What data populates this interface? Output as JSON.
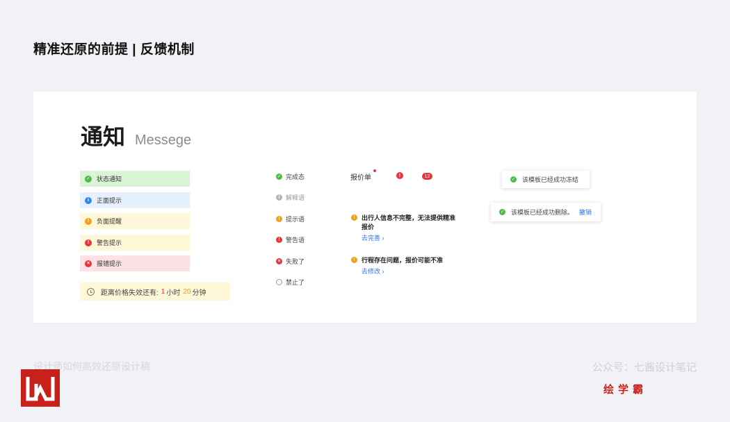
{
  "header": {
    "title": "精准还原的前提 | 反馈机制"
  },
  "card": {
    "title_zh": "通知",
    "title_en": "Messege"
  },
  "notices": [
    {
      "label": "状态通知",
      "bg": "#d9f5d6",
      "color": "#4fb94a",
      "icon": "check-circle-icon",
      "glyph": "✓"
    },
    {
      "label": "正面提示",
      "bg": "#e7f1fd",
      "color": "#2f8be6",
      "icon": "info-circle-icon",
      "glyph": "i"
    },
    {
      "label": "负面提醒",
      "bg": "#fff8d8",
      "color": "#f0a020",
      "icon": "warning-circle-icon",
      "glyph": "!"
    },
    {
      "label": "警告提示",
      "bg": "#fff8d8",
      "color": "#e8343f",
      "icon": "alert-circle-icon",
      "glyph": "!"
    },
    {
      "label": "报错提示",
      "bg": "#fde1e4",
      "color": "#e8343f",
      "icon": "error-circle-icon",
      "glyph": "×"
    }
  ],
  "timer": {
    "prefix": "距离价格失效还有:",
    "hours": "1",
    "hour_unit": "小时",
    "minutes": "20",
    "minute_unit": "分钟"
  },
  "statuses": [
    {
      "label": "完成态",
      "color": "#4fb94a",
      "icon": "check-circle-icon",
      "glyph": "✓"
    },
    {
      "label": "解释语",
      "color": "#b5b5b5",
      "icon": "info-circle-icon",
      "glyph": "i"
    },
    {
      "label": "提示语",
      "color": "#f0a020",
      "icon": "warning-circle-icon",
      "glyph": "!"
    },
    {
      "label": "警告语",
      "color": "#e8343f",
      "icon": "alert-circle-icon",
      "glyph": "!"
    },
    {
      "label": "失败了",
      "color": "#e8343f",
      "icon": "error-circle-icon",
      "glyph": "×"
    },
    {
      "label": "禁止了",
      "color": "#9a9a9a",
      "icon": "forbidden-icon",
      "glyph": "⃠"
    }
  ],
  "quote": {
    "label": "报价单",
    "badge_count": "12",
    "badge_glyph": "!"
  },
  "tips": [
    {
      "text_line1": "出行人信息不完整，无法提供精准",
      "text_line2": "报价",
      "link": "去完善  ›"
    },
    {
      "text_line1": "行程存在问题，报价可能不准",
      "text_line2": "",
      "link": "去修改  ›"
    }
  ],
  "toasts": {
    "freeze": "该模板已经成功冻结",
    "delete": "该模板已经成功删除。",
    "undo": "撤销"
  },
  "footer": {
    "left": "设计师如何高效还原设计稿",
    "right": "公众号：七酱设计笔记",
    "brand": "绘学霸"
  },
  "colors": {
    "brand_red": "#c8211c",
    "link_blue": "#2f6fe0",
    "success": "#4fb94a",
    "danger": "#e8343f",
    "warning": "#f0a020"
  }
}
